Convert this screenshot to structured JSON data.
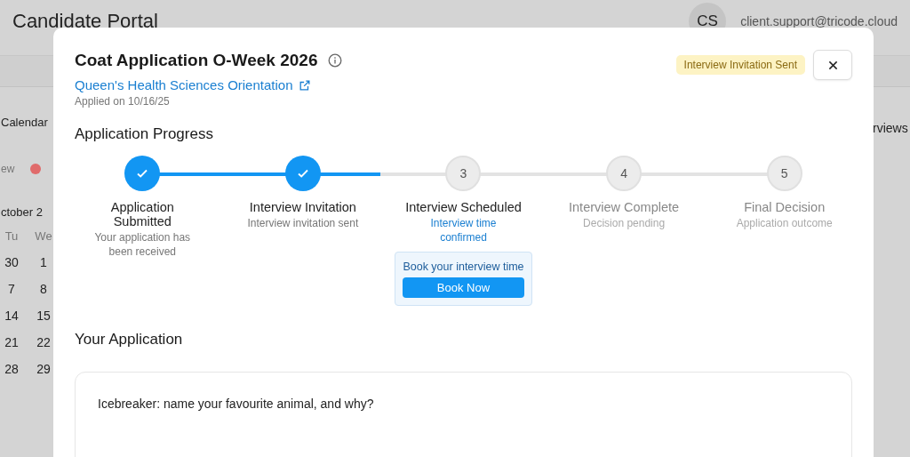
{
  "page": {
    "title": "Candidate Portal",
    "avatar": "CS",
    "email": "client.support@tricode.cloud",
    "calendar": {
      "heading": "Calendar",
      "legend": "ew",
      "color": "#e06b6b",
      "month": "ctober 2",
      "weekdays": [
        "Tu",
        "We"
      ],
      "weeks": [
        [
          "30",
          "1"
        ],
        [
          "7",
          "8"
        ],
        [
          "14",
          "15"
        ],
        [
          "21",
          "22"
        ],
        [
          "28",
          "29"
        ]
      ]
    },
    "right_heading": "rviews"
  },
  "modal": {
    "title": "Coat Application O-Week 2026",
    "link": "Queen's Health Sciences Orientation",
    "applied": "Applied on 10/16/25",
    "status": "Interview Invitation Sent",
    "progress": {
      "heading": "Application Progress",
      "level": 0.37,
      "steps": [
        {
          "title": "Application Submitted",
          "subtitle": "Your application has been received",
          "completed": true,
          "active": false
        },
        {
          "title": "Interview Invitation",
          "subtitle": "Interview invitation sent",
          "completed": true,
          "active": false
        },
        {
          "number": "3",
          "title": "Interview Scheduled",
          "subtitle": "Interview time confirmed",
          "completed": false,
          "active": true,
          "action": {
            "prompt": "Book your interview time",
            "button": "Book Now"
          }
        },
        {
          "number": "4",
          "title": "Interview Complete",
          "subtitle": "Decision pending",
          "completed": false,
          "active": false
        },
        {
          "number": "5",
          "title": "Final Decision",
          "subtitle": "Application outcome",
          "completed": false,
          "active": false
        }
      ]
    },
    "application": {
      "heading": "Your Application",
      "question": "Icebreaker: name your favourite animal, and why?"
    }
  }
}
